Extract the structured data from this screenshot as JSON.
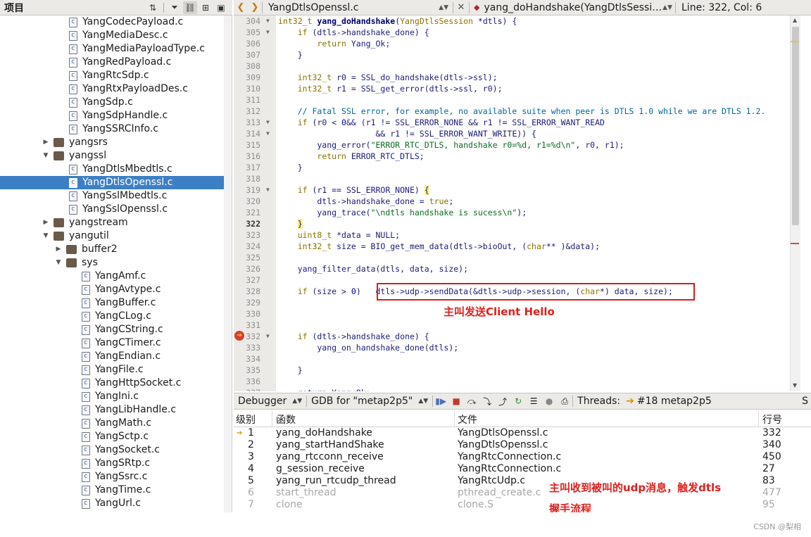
{
  "project_panel": {
    "title": "项目",
    "tree": [
      {
        "label": "YangCodecPayload.c",
        "type": "file",
        "depth": 2
      },
      {
        "label": "YangMediaDesc.c",
        "type": "file",
        "depth": 2
      },
      {
        "label": "YangMediaPayloadType.c",
        "type": "file",
        "depth": 2
      },
      {
        "label": "YangRedPayload.c",
        "type": "file",
        "depth": 2
      },
      {
        "label": "YangRtcSdp.c",
        "type": "file",
        "depth": 2
      },
      {
        "label": "YangRtxPayloadDes.c",
        "type": "file",
        "depth": 2
      },
      {
        "label": "YangSdp.c",
        "type": "file",
        "depth": 2
      },
      {
        "label": "YangSdpHandle.c",
        "type": "file",
        "depth": 2
      },
      {
        "label": "YangSSRCInfo.c",
        "type": "file",
        "depth": 2
      },
      {
        "label": "yangsrs",
        "type": "folder",
        "depth": 1,
        "expanded": false
      },
      {
        "label": "yangssl",
        "type": "folder",
        "depth": 1,
        "expanded": true
      },
      {
        "label": "YangDtlsMbedtls.c",
        "type": "file",
        "depth": 2
      },
      {
        "label": "YangDtlsOpenssl.c",
        "type": "file",
        "depth": 2,
        "selected": true
      },
      {
        "label": "YangSslMbedtls.c",
        "type": "file",
        "depth": 2
      },
      {
        "label": "YangSslOpenssl.c",
        "type": "file",
        "depth": 2
      },
      {
        "label": "yangstream",
        "type": "folder",
        "depth": 1,
        "expanded": false
      },
      {
        "label": "yangutil",
        "type": "folder",
        "depth": 1,
        "expanded": true
      },
      {
        "label": "buffer2",
        "type": "folder",
        "depth": 2,
        "expanded": false
      },
      {
        "label": "sys",
        "type": "folder",
        "depth": 2,
        "expanded": true
      },
      {
        "label": "YangAmf.c",
        "type": "file",
        "depth": 3
      },
      {
        "label": "YangAvtype.c",
        "type": "file",
        "depth": 3
      },
      {
        "label": "YangBuffer.c",
        "type": "file",
        "depth": 3
      },
      {
        "label": "YangCLog.c",
        "type": "file",
        "depth": 3
      },
      {
        "label": "YangCString.c",
        "type": "file",
        "depth": 3
      },
      {
        "label": "YangCTimer.c",
        "type": "file",
        "depth": 3
      },
      {
        "label": "YangEndian.c",
        "type": "file",
        "depth": 3
      },
      {
        "label": "YangFile.c",
        "type": "file",
        "depth": 3
      },
      {
        "label": "YangHttpSocket.c",
        "type": "file",
        "depth": 3
      },
      {
        "label": "YangIni.c",
        "type": "file",
        "depth": 3
      },
      {
        "label": "YangLibHandle.c",
        "type": "file",
        "depth": 3
      },
      {
        "label": "YangMath.c",
        "type": "file",
        "depth": 3
      },
      {
        "label": "YangSctp.c",
        "type": "file",
        "depth": 3
      },
      {
        "label": "YangSocket.c",
        "type": "file",
        "depth": 3
      },
      {
        "label": "YangSRtp.c",
        "type": "file",
        "depth": 3
      },
      {
        "label": "YangSsrc.c",
        "type": "file",
        "depth": 3
      },
      {
        "label": "YangTime.c",
        "type": "file",
        "depth": 3
      },
      {
        "label": "YangUrl.c",
        "type": "file",
        "depth": 3
      }
    ]
  },
  "editor_bar": {
    "back": "❮",
    "forward": "❯",
    "file_name": "YangDtlsOpenssl.c",
    "close": "✕",
    "function_name": "yang_doHandshake(YangDtlsSessi…",
    "line_col": "Line: 322, Col: 6"
  },
  "code": {
    "lines": [
      {
        "n": "304",
        "fold": true,
        "html": "<span class='tp'>int32_t</span> <span class='fnb'>yang_doHandshake</span>(<span class='tp'>YangDtlsSession</span> *dtls) {"
      },
      {
        "n": "305",
        "fold": true,
        "html": "    <span class='kw'>if</span> (dtls->handshake_done) {"
      },
      {
        "n": "306",
        "html": "        <span class='kw'>return</span> Yang_Ok;"
      },
      {
        "n": "307",
        "html": "    }"
      },
      {
        "n": "308",
        "html": ""
      },
      {
        "n": "309",
        "html": "    <span class='tp'>int32_t</span> r0 = SSL_do_handshake(dtls->ssl);"
      },
      {
        "n": "310",
        "html": "    <span class='tp'>int32_t</span> r1 = SSL_get_error(dtls->ssl, r0);"
      },
      {
        "n": "311",
        "html": ""
      },
      {
        "n": "312",
        "html": "    <span class='cm'>// Fatal SSL error, for example, no available suite when peer is DTLS 1.0 while we are DTLS 1.2.</span>"
      },
      {
        "n": "313",
        "fold": true,
        "html": "    <span class='kw'>if</span> (r0 &lt; <span class='num'>0</span>&amp;&amp; (r1 != SSL_ERROR_NONE &amp;&amp; r1 != SSL_ERROR_WANT_READ"
      },
      {
        "n": "314",
        "fold": true,
        "html": "                    &amp;&amp; r1 != SSL_ERROR_WANT_WRITE)) {"
      },
      {
        "n": "315",
        "html": "        yang_error(<span class='st'>\"ERROR_RTC_DTLS, handshake r0=%d, r1=%d\\n\"</span>, r0, r1);"
      },
      {
        "n": "316",
        "html": "        <span class='kw'>return</span> ERROR_RTC_DTLS;"
      },
      {
        "n": "317",
        "html": "    }"
      },
      {
        "n": "318",
        "html": ""
      },
      {
        "n": "319",
        "fold": true,
        "html": "    <span class='kw'>if</span> (r1 == SSL_ERROR_NONE) <span class='brk'>{</span>"
      },
      {
        "n": "320",
        "html": "        dtls->handshake_done = <span class='kw'>true</span>;"
      },
      {
        "n": "321",
        "html": "        yang_trace(<span class='st'>\"\\ndtls handshake is sucess\\n\"</span>);"
      },
      {
        "n": "322",
        "cur": true,
        "html": "    <span class='brk'>}</span>"
      },
      {
        "n": "323",
        "html": "    <span class='tp'>uint8_t</span> *data = NULL;"
      },
      {
        "n": "324",
        "html": "    <span class='tp'>int32_t</span> size = BIO_get_mem_data(dtls->bioOut, (<span class='kw'>char</span>** )&amp;data);"
      },
      {
        "n": "325",
        "html": ""
      },
      {
        "n": "326",
        "html": "    yang_filter_data(dtls, data, size);"
      },
      {
        "n": "327",
        "html": ""
      },
      {
        "n": "328",
        "html": "    <span class='kw'>if</span> (size &gt; <span class='num'>0</span>)   dtls->udp->sendData(&amp;dtls->udp->session, (<span class='kw'>char</span>*) data, size);"
      },
      {
        "n": "329",
        "html": ""
      },
      {
        "n": "330",
        "html": ""
      },
      {
        "n": "331",
        "html": ""
      },
      {
        "n": "332",
        "fold": true,
        "bp": true,
        "html": "    <span class='kw'>if</span> (dtls->handshake_done) {"
      },
      {
        "n": "333",
        "html": "        yang_on_handshake_done(dtls);"
      },
      {
        "n": "334",
        "html": ""
      },
      {
        "n": "335",
        "html": "    }"
      },
      {
        "n": "336",
        "html": ""
      },
      {
        "n": "337",
        "html": "    return Yang_Ok;"
      }
    ],
    "annotation": "主叫发送Client Hello"
  },
  "debugger": {
    "mode": "Debugger",
    "session": "GDB for \"metap2p5\"",
    "threads_label": "Threads:",
    "thread": "#18 metap2p5",
    "trailing": "S",
    "headers": {
      "level": "级别",
      "function": "函数",
      "file": "文件",
      "line": "行号"
    },
    "frames": [
      {
        "level": "1",
        "function": "yang_doHandshake",
        "file": "YangDtlsOpenssl.c",
        "line": "332",
        "current": true
      },
      {
        "level": "2",
        "function": "yang_startHandShake",
        "file": "YangDtlsOpenssl.c",
        "line": "340"
      },
      {
        "level": "3",
        "function": "yang_rtcconn_receive",
        "file": "YangRtcConnection.c",
        "line": "450"
      },
      {
        "level": "4",
        "function": "g_session_receive",
        "file": "YangRtcConnection.c",
        "line": "27"
      },
      {
        "level": "5",
        "function": "yang_run_rtcudp_thread",
        "file": "YangRtcUdp.c",
        "line": "83"
      },
      {
        "level": "6",
        "function": "start_thread",
        "file": "pthread_create.c",
        "line": "477",
        "dim": true
      },
      {
        "level": "7",
        "function": "clone",
        "file": "clone.S",
        "line": "95",
        "dim": true
      }
    ],
    "annotation_line1": "主叫收到被叫的udp消息，触发dtls",
    "annotation_line2": "握手流程"
  },
  "watermark": "CSDN @梨相"
}
